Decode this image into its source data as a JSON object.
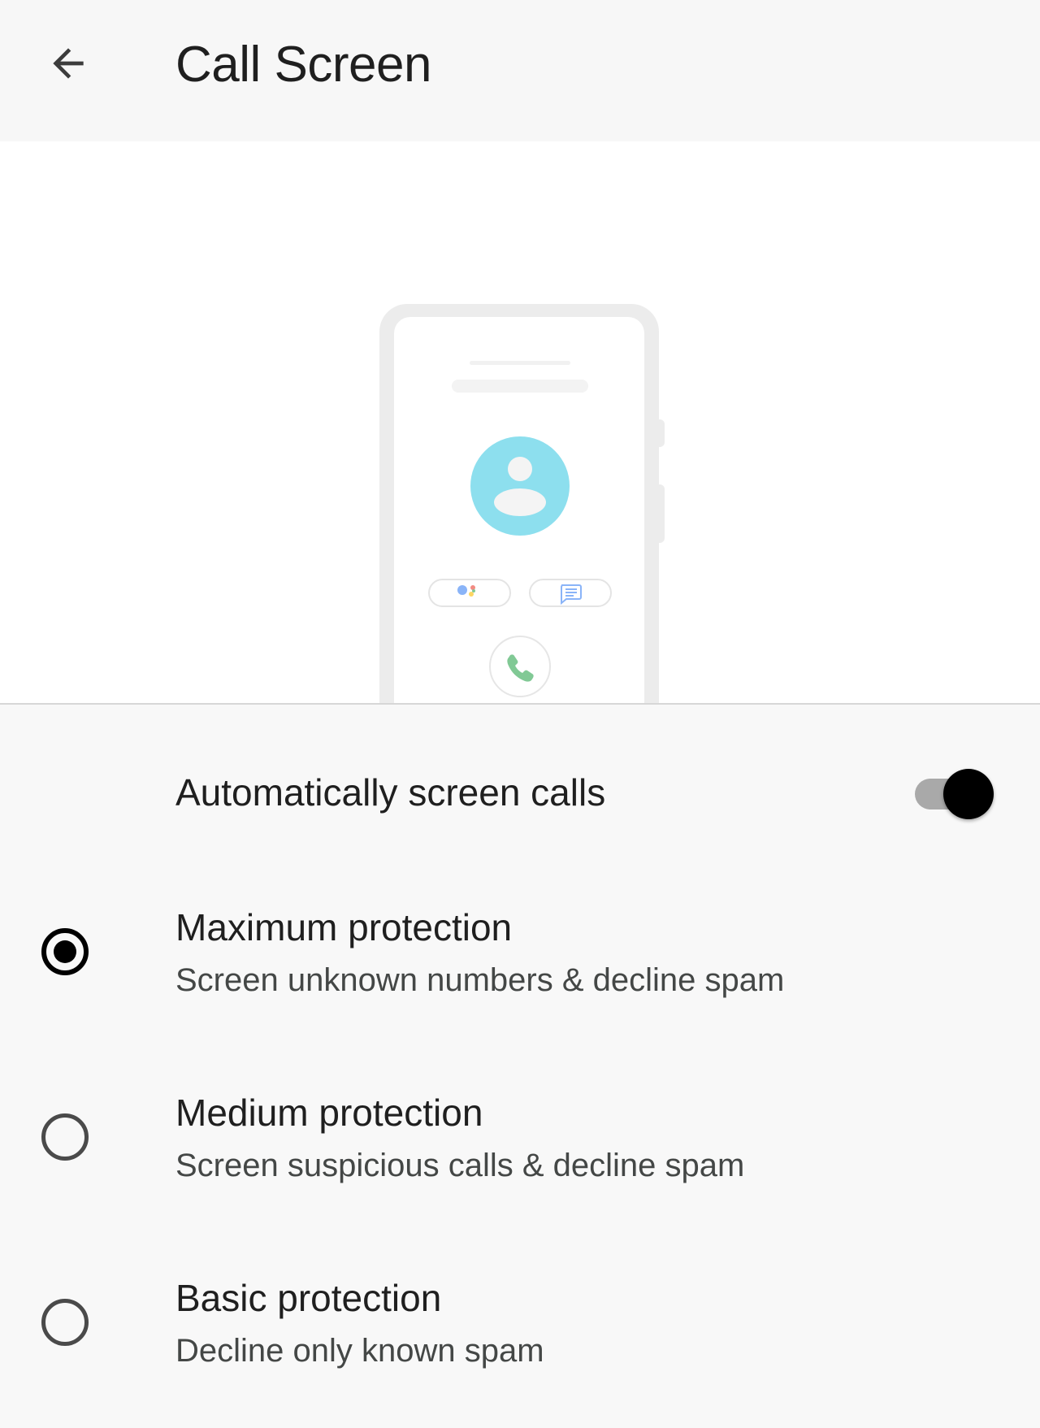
{
  "header": {
    "back_icon": "arrow-back-icon",
    "title": "Call Screen"
  },
  "illustration": {
    "contact_icon": "person-icon",
    "assistant_icon": "google-assistant-icon",
    "message_icon": "message-icon",
    "phone_icon": "phone-icon",
    "colors": {
      "avatar": "#8ddfee",
      "phone_green": "#34a853",
      "message_blue": "#4285f4"
    }
  },
  "auto_screen": {
    "label": "Automatically screen calls",
    "enabled": true
  },
  "options": [
    {
      "title": "Maximum protection",
      "subtitle": "Screen unknown numbers & decline spam",
      "selected": true
    },
    {
      "title": "Medium protection",
      "subtitle": "Screen suspicious calls & decline spam",
      "selected": false
    },
    {
      "title": "Basic protection",
      "subtitle": "Decline only known spam",
      "selected": false
    }
  ]
}
